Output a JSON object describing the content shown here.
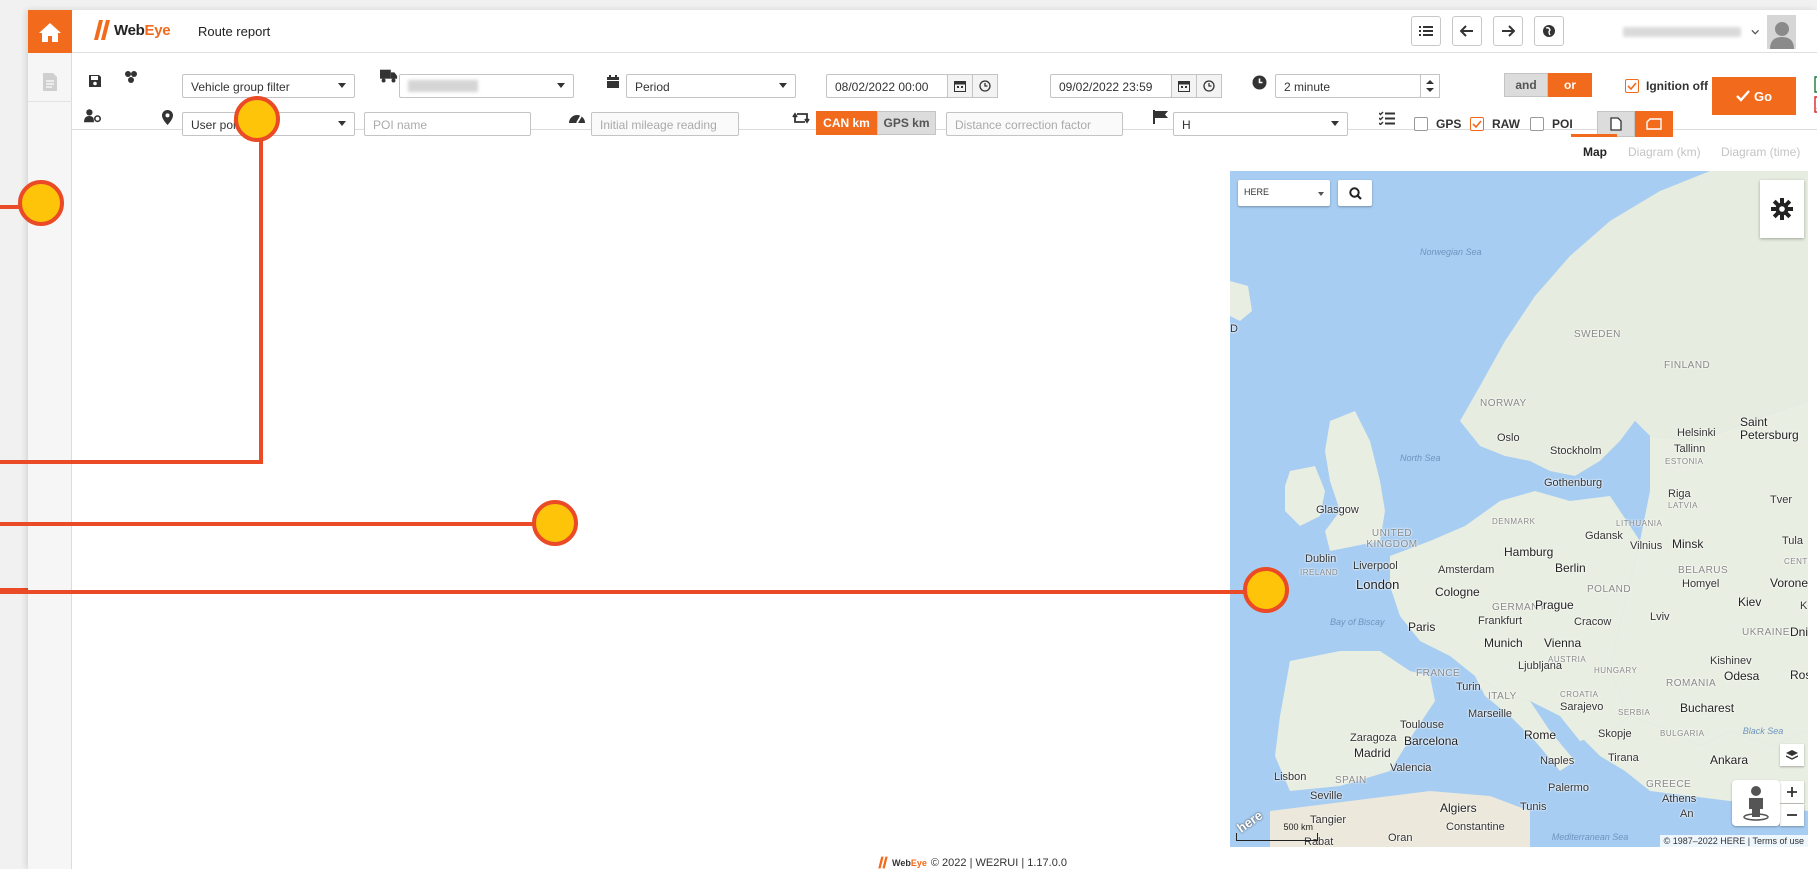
{
  "header": {
    "logo_web": "Web",
    "logo_eye": "Eye",
    "page_title": "Route report",
    "tools": [
      {
        "name": "list-icon"
      },
      {
        "name": "arrow-left-icon"
      },
      {
        "name": "arrow-right-icon"
      },
      {
        "name": "globe-icon"
      }
    ]
  },
  "filters": {
    "vehicle_group": "Vehicle group filter",
    "period": "Period",
    "date_from": "08/02/2022 00:00",
    "date_to": "09/02/2022 23:59",
    "interval": "2 minute",
    "and_label": "and",
    "or_label": "or",
    "ignition_off_label": "Ignition off",
    "ignition_off_checked": true,
    "user_point": "User point",
    "poi_name_placeholder": "POI name",
    "mileage_placeholder": "Initial mileage reading",
    "can_km_label": "CAN km",
    "gps_km_label": "GPS km",
    "distance_factor_placeholder": "Distance correction factor",
    "flag_value": "H",
    "gps_label": "GPS",
    "gps_checked": false,
    "raw_label": "RAW",
    "raw_checked": true,
    "poi_label": "POI",
    "poi_checked": false,
    "go_label": "Go"
  },
  "view_tabs": [
    {
      "label": "Map",
      "active": true
    },
    {
      "label": "Diagram (km)",
      "active": false
    },
    {
      "label": "Diagram (time)",
      "active": false
    }
  ],
  "map": {
    "provider": "HERE",
    "scale": "500 km",
    "copyright": "© 1987–2022 HERE | Terms of use",
    "labels": {
      "norwegian_sea": "Norwegian Sea",
      "north_sea": "North Sea",
      "bay_of_biscay": "Bay of Biscay",
      "black_sea": "Black Sea",
      "mediterranean": "Mediterranean Sea",
      "sweden": "SWEDEN",
      "finland": "FINLAND",
      "norway": "NORWAY",
      "estonia": "ESTONIA",
      "latvia": "LATVIA",
      "lithuania": "LITHUANIA",
      "belarus": "BELARUS",
      "uk": "UNITED KINGDOM",
      "ireland": "IRELAND",
      "denmark": "DENMARK",
      "poland": "POLAND",
      "germany": "GERMANY",
      "ukraine": "UKRAINE",
      "france": "FRANCE",
      "italy": "ITALY",
      "spain": "SPAIN",
      "romania": "ROMANIA",
      "austria": "AUSTRIA",
      "hungary": "HUNGARY",
      "serbia": "SERBIA",
      "croatia": "CROATIA",
      "bulgaria": "BULGARIA",
      "greece": "GREECE",
      "centr": "CENTR",
      "d": "D",
      "helsinki": "Helsinki",
      "saint_petersburg": "Saint Petersburg",
      "tallinn": "Tallinn",
      "oslo": "Oslo",
      "stockholm": "Stockholm",
      "gothenburg": "Gothenburg",
      "riga": "Riga",
      "tver": "Tver",
      "glasgow": "Glasgow",
      "dublin": "Dublin",
      "liverpool": "Liverpool",
      "london": "London",
      "hamburg": "Hamburg",
      "berlin": "Berlin",
      "amsterdam": "Amsterdam",
      "gdansk": "Gdansk",
      "vilnius": "Vilnius",
      "minsk": "Minsk",
      "tula": "Tula",
      "homyel": "Homyel",
      "voronezh": "Vorone",
      "cologne": "Cologne",
      "frankfurt": "Frankfurt",
      "prague": "Prague",
      "kiev": "Kiev",
      "paris": "Paris",
      "cracow": "Cracow",
      "lviv": "Lviv",
      "dnipro": "Dni",
      "k": "K",
      "munich": "Munich",
      "vienna": "Vienna",
      "kishinev": "Kishinev",
      "odesa": "Odesa",
      "rostov": "Rost",
      "ljubljana": "Ljubljana",
      "turin": "Turin",
      "sarajevo": "Sarajevo",
      "bucharest": "Bucharest",
      "marseille": "Marseille",
      "toulouse": "Toulouse",
      "zaragoza": "Zaragoza",
      "barcelona": "Barcelona",
      "rome": "Rome",
      "skopje": "Skopje",
      "madrid": "Madrid",
      "valencia": "Valencia",
      "tirana": "Tirana",
      "ankara": "Ankara",
      "lisbon": "Lisbon",
      "naples": "Naples",
      "palermo": "Palermo",
      "seville": "Seville",
      "athens": "Athens",
      "algiers": "Algiers",
      "tunis": "Tunis",
      "an": "An",
      "tangier": "Tangier",
      "constantine": "Constantine",
      "rabat": "Rabat",
      "oran": "Oran"
    }
  },
  "footer": {
    "logo_web": "Web",
    "logo_eye": "Eye",
    "text": "© 2022 | WE2RUI | 1.17.0.0"
  },
  "colors": {
    "brand_orange": "#f26a1b",
    "annotation_red": "#ea4a25",
    "annotation_yellow": "#fdc40a",
    "sea_blue": "#a7cdf2",
    "land": "#e9eee2"
  }
}
